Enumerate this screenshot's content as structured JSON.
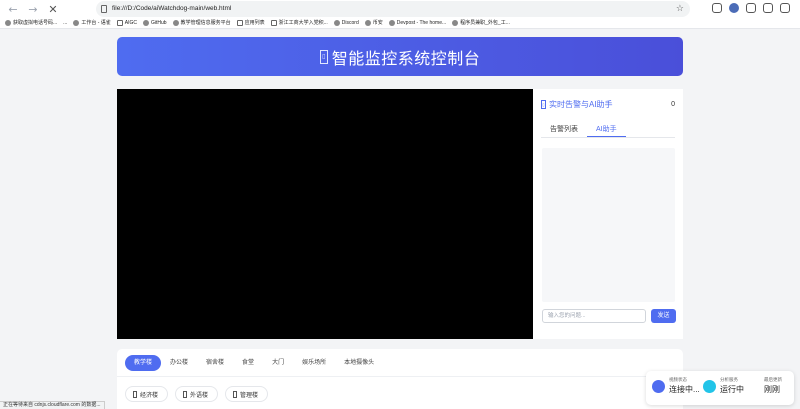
{
  "browser": {
    "url": "file:///D:/Code/aiWatchdog-main/web.html",
    "bookmarks": [
      "获取虚拟电话号码...",
      "...",
      "工作台 - 语雀",
      "AIGC",
      "GitHub",
      "教学管理信息服务平台",
      "应用列表",
      "浙江工商大学入党积...",
      "Discord",
      "币安",
      "Devpost - The home...",
      "程序员兼职_外包_工..."
    ],
    "status_text": "正在等待来自 cdnjs.cloudflare.com 的数据..."
  },
  "header": {
    "title": "智能监控系统控制台"
  },
  "side_panel": {
    "title": "实时告警与AI助手",
    "count": "0",
    "tabs": [
      "告警列表",
      "AI助手"
    ],
    "input_placeholder": "输入您的问题...",
    "send_label": "发送"
  },
  "bottom": {
    "tabs": [
      "教学楼",
      "办公楼",
      "宿舍楼",
      "食堂",
      "大门",
      "娱乐场所",
      "本地摄像头"
    ],
    "buildings": [
      "经济楼",
      "外语楼",
      "管理楼"
    ]
  },
  "status_card": {
    "items": [
      {
        "label": "视频状态",
        "value": "连接中..."
      },
      {
        "label": "分析服务",
        "value": "运行中"
      },
      {
        "label": "最后更新",
        "value": "刚刚"
      }
    ]
  },
  "colors": {
    "accent": "#4f6cf0",
    "cyan": "#22c4e8"
  }
}
